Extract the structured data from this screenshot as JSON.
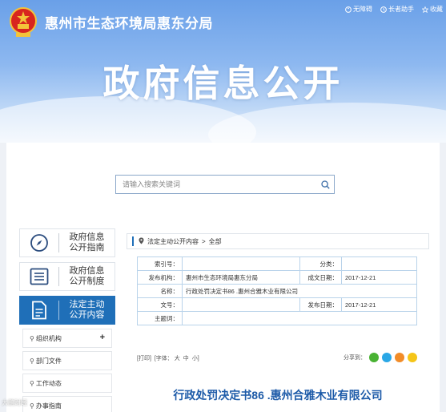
{
  "header": {
    "site_title": "惠州市生态环境局惠东分局",
    "banner_title": "政府信息公开",
    "links": [
      "无障碍",
      "长者助手",
      "收藏"
    ]
  },
  "search": {
    "placeholder": "请输入搜索关键词"
  },
  "sidebar": {
    "items": [
      {
        "label_line1": "政府信息",
        "label_line2": "公开指南",
        "icon": "compass-icon",
        "active": false
      },
      {
        "label_line1": "政府信息",
        "label_line2": "公开制度",
        "icon": "list-icon",
        "active": false
      },
      {
        "label_line1": "法定主动",
        "label_line2": "公开内容",
        "icon": "document-icon",
        "active": true
      }
    ],
    "sub_items": [
      {
        "label": "组织机构",
        "expandable": true,
        "expand_symbol": "+"
      },
      {
        "label": "部门文件",
        "expandable": false
      },
      {
        "label": "工作动态",
        "expandable": false
      },
      {
        "label": "办事指南",
        "expandable": false
      }
    ]
  },
  "breadcrumb": {
    "section": "法定主动公开内容",
    "separator": ">",
    "current": "全部"
  },
  "info_table": {
    "index_label": "索引号：",
    "index_value": "",
    "category_label": "分类：",
    "category_value": "",
    "publisher_label": "发布机构：",
    "publisher_value": "惠州市生态环境局惠东分局",
    "created_label": "成文日期：",
    "created_value": "2017-12-21",
    "name_label": "名称：",
    "name_value": "行政处罚决定书86 .惠州合雅木业有限公司",
    "docno_label": "文号：",
    "docno_value": "",
    "published_label": "发布日期：",
    "published_value": "2017-12-21",
    "topic_label": "主题词：",
    "topic_value": ""
  },
  "tools": {
    "print": "[打印]",
    "font": "[字体：",
    "font_large": "大",
    "font_medium": "中",
    "font_small": "小]",
    "share_label": "分享到："
  },
  "share_colors": [
    "#49b233",
    "#2aa7e6",
    "#f28c28",
    "#f5c518"
  ],
  "document": {
    "title": "行政处罚决定书86 .惠州合雅木业有限公司"
  },
  "watermark": "大鹏财经"
}
